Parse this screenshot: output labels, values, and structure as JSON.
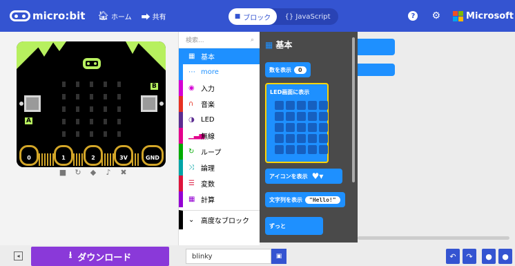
{
  "header": {
    "brand": "micro:bit",
    "home_label": "ホーム",
    "share_label": "共有",
    "blocks_label": "ブロック",
    "js_label": "{} JavaScript",
    "help": "?",
    "account": "Microsoft",
    "ms_logo_colors": [
      "#f25022",
      "#7fba00",
      "#00a4ef",
      "#ffb900"
    ]
  },
  "simulator": {
    "pins": [
      "0",
      "1",
      "2",
      "3V",
      "GND"
    ],
    "button_a": "A",
    "button_b": "B",
    "controls": [
      "stop",
      "restart",
      "slowmo",
      "mute",
      "fullscreen"
    ]
  },
  "toolbox": {
    "search_placeholder": "検索...",
    "categories": [
      {
        "icon": "grid",
        "label": "基本",
        "color": "#1e90ff"
      },
      {
        "icon": "more",
        "label": "more",
        "color": "#1e90ff"
      },
      {
        "icon": "input",
        "label": "入力",
        "color": "#d400d4"
      },
      {
        "icon": "music",
        "label": "音楽",
        "color": "#e63022"
      },
      {
        "icon": "led",
        "label": "LED",
        "color": "#5c2d91"
      },
      {
        "icon": "radio",
        "label": "無線",
        "color": "#e3008c"
      },
      {
        "icon": "loop",
        "label": "ループ",
        "color": "#00aa00"
      },
      {
        "icon": "logic",
        "label": "論理",
        "color": "#00a4a6"
      },
      {
        "icon": "variables",
        "label": "変数",
        "color": "#dc143c"
      },
      {
        "icon": "math",
        "label": "計算",
        "color": "#9400d3"
      }
    ],
    "advanced_label": "高度なブロック"
  },
  "flyout": {
    "title": "基本",
    "show_number_label": "数を表示",
    "show_number_value": "0",
    "show_leds_label": "LED画面に表示",
    "show_icon_label": "アイコンを表示",
    "show_string_label": "文字列を表示",
    "show_string_value": "\"Hello!\"",
    "forever_label": "ずっと"
  },
  "footer": {
    "download_label": "ダウンロード",
    "project_name": "blinky"
  }
}
